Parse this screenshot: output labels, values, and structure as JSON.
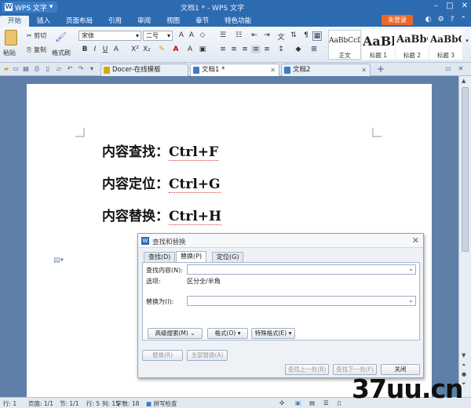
{
  "titlebar": {
    "app_name": "WPS 文字",
    "window_title": "文档1 * - WPS 文字",
    "controls": [
      "–",
      "□",
      "✕"
    ]
  },
  "menubar": {
    "tabs": [
      "开始",
      "插入",
      "页面布局",
      "引用",
      "审阅",
      "视图",
      "章节",
      "特色功能"
    ],
    "active": "开始",
    "login_label": "未登录"
  },
  "ribbon": {
    "paste": "粘贴",
    "cut": "剪切",
    "copy": "复制",
    "format_painter": "格式刷",
    "font_name": "宋体",
    "font_size": "二号",
    "styles": [
      {
        "sample": "AaBbCcDd",
        "name": "正文"
      },
      {
        "sample": "AaBl",
        "name": "标题 1"
      },
      {
        "sample": "AaBbC",
        "name": "标题 2"
      },
      {
        "sample": "AaBbC",
        "name": "标题 3"
      }
    ]
  },
  "tabs": {
    "items": [
      {
        "label": "Docer-在线模板",
        "active": false
      },
      {
        "label": "文档1 *",
        "active": true
      },
      {
        "label": "文档2",
        "active": false
      }
    ],
    "add": "+"
  },
  "document": {
    "lines": [
      {
        "text": "内容查找：",
        "shortcut": "Ctrl+F"
      },
      {
        "text": "内容定位：",
        "shortcut": "Ctrl+G"
      },
      {
        "text": "内容替换：",
        "shortcut": "Ctrl+H"
      }
    ]
  },
  "dialog": {
    "title": "查找和替换",
    "tabs": [
      "查找(D)",
      "替换(P)",
      "定位(G)"
    ],
    "active_tab": "替换(P)",
    "find_label": "查找内容(N):",
    "find_value": "",
    "options_label": "选项:",
    "options_value": "区分全/半角",
    "replace_label": "替换为(I):",
    "replace_value": "",
    "advanced_btn": "高级搜索(M)",
    "format_btn": "格式(O)",
    "special_btn": "特殊格式(E)",
    "replace_btn": "替换(R)",
    "replace_all_btn": "全部替换(A)",
    "find_prev_btn": "查找上一处(B)",
    "find_next_btn": "查找下一处(F)",
    "close_btn": "关闭"
  },
  "statusbar": {
    "items": [
      "行: 1",
      "页面: 1/1",
      "节: 1/1",
      "行: 5",
      "列: 15",
      "字数: 18",
      "拼写检查"
    ]
  },
  "watermark": "37uu.cn"
}
